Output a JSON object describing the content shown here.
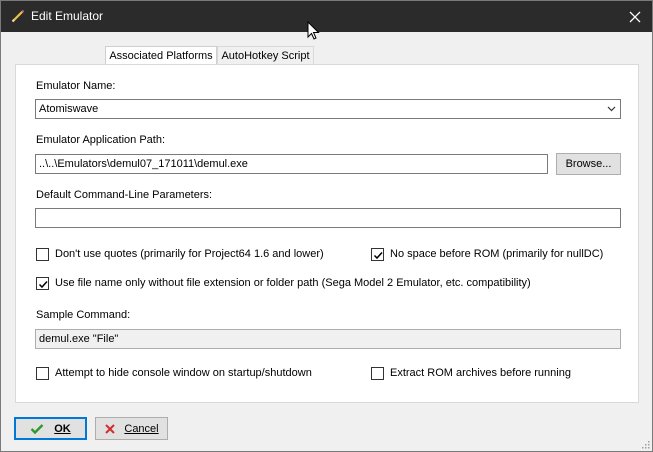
{
  "window": {
    "title": "Edit Emulator",
    "close_icon": "close-icon",
    "title_icon": "pencil-icon"
  },
  "tabs": [
    {
      "label": "Associated Platforms",
      "active": true
    },
    {
      "label": "AutoHotkey Script",
      "active": false
    }
  ],
  "form": {
    "emulator_name_label": "Emulator Name:",
    "emulator_name_value": "Atomiswave",
    "app_path_label": "Emulator Application Path:",
    "app_path_value": "..\\..\\Emulators\\demul07_171011\\demul.exe",
    "browse_label": "Browse...",
    "params_label": "Default Command-Line Parameters:",
    "params_value": "",
    "dont_use_quotes": {
      "label": "Don't use quotes (primarily for Project64 1.6 and lower)",
      "checked": false
    },
    "no_space_before_rom": {
      "label": "No space before ROM (primarily for nullDC)",
      "checked": true
    },
    "use_file_name_only": {
      "label": "Use file name only without file extension or folder path (Sega Model 2 Emulator, etc. compatibility)",
      "checked": true
    },
    "sample_label": "Sample Command:",
    "sample_value": "demul.exe \"File\"",
    "hide_console": {
      "label": "Attempt to hide console window on startup/shutdown",
      "checked": false
    },
    "extract_rom": {
      "label": "Extract ROM archives before running",
      "checked": false
    }
  },
  "footer": {
    "ok_label": "OK",
    "cancel_label": "Cancel"
  },
  "colors": {
    "titlebar": "#2b2b2b",
    "accent": "#0078d7",
    "ok_check": "#2e9a2e",
    "cancel_x": "#d03030"
  }
}
